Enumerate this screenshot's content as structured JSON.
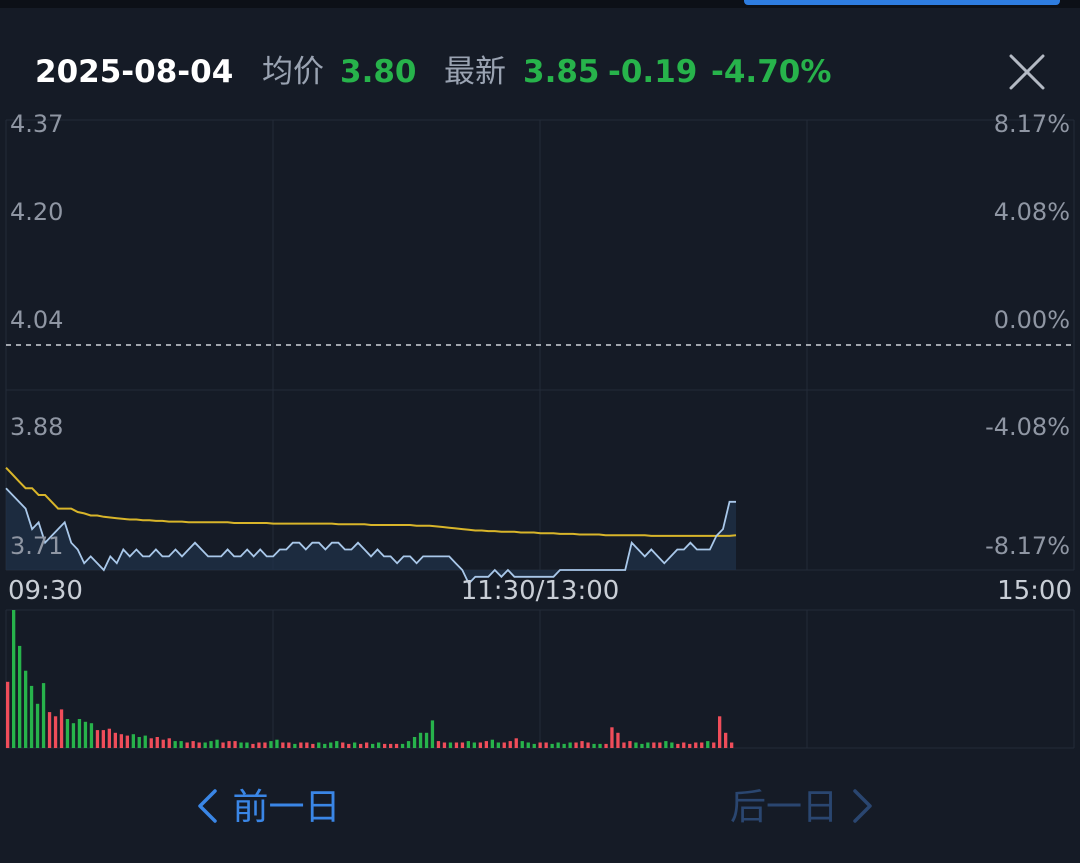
{
  "header": {
    "date": "2025-08-04",
    "avg_label": "均价",
    "avg_value": "3.80",
    "latest_label": "最新",
    "latest_value": "3.85",
    "change": "-0.19",
    "change_pct": "-4.70%"
  },
  "nav": {
    "prev_label": "前一日",
    "next_label": "后一日"
  },
  "colors": {
    "background": "#151b26",
    "price_line": "#a9c8ea",
    "avg_line": "#d8b52a",
    "up": "#ef4d5a",
    "down": "#27b34b",
    "prev_nav": "#3a86e6",
    "next_nav_disabled": "#2a4670"
  },
  "chart_data": {
    "type": "line",
    "ylim": [
      3.71,
      4.37
    ],
    "y_ticks_left": [
      "4.37",
      "4.20",
      "4.04",
      "3.88",
      "3.71"
    ],
    "y_ticks_right": [
      "8.17%",
      "4.08%",
      "0.00%",
      "-4.08%",
      "-8.17%"
    ],
    "x_ticks": [
      "09:30",
      "11:30/13:00",
      "15:00"
    ],
    "prev_close": 4.04,
    "series": [
      {
        "key": "price",
        "values": [
          3.83,
          3.82,
          3.81,
          3.8,
          3.77,
          3.78,
          3.75,
          3.76,
          3.77,
          3.78,
          3.75,
          3.74,
          3.72,
          3.73,
          3.72,
          3.71,
          3.73,
          3.72,
          3.74,
          3.73,
          3.74,
          3.73,
          3.73,
          3.74,
          3.73,
          3.73,
          3.74,
          3.73,
          3.74,
          3.75,
          3.74,
          3.73,
          3.73,
          3.73,
          3.74,
          3.73,
          3.73,
          3.74,
          3.73,
          3.74,
          3.73,
          3.73,
          3.74,
          3.74,
          3.75,
          3.75,
          3.74,
          3.75,
          3.75,
          3.74,
          3.75,
          3.75,
          3.74,
          3.74,
          3.75,
          3.74,
          3.73,
          3.74,
          3.73,
          3.73,
          3.72,
          3.73,
          3.73,
          3.72,
          3.73,
          3.73,
          3.73,
          3.73,
          3.73,
          3.72,
          3.71,
          3.69,
          3.7,
          3.7,
          3.7,
          3.71,
          3.7,
          3.71,
          3.7,
          3.7,
          3.7,
          3.7,
          3.7,
          3.7,
          3.7,
          3.71,
          3.71,
          3.71,
          3.71,
          3.71,
          3.71,
          3.71,
          3.71,
          3.71,
          3.71,
          3.71,
          3.75,
          3.74,
          3.73,
          3.74,
          3.73,
          3.72,
          3.73,
          3.74,
          3.74,
          3.75,
          3.74,
          3.74,
          3.74,
          3.76,
          3.77,
          3.81,
          3.81
        ]
      },
      {
        "key": "average",
        "values": [
          3.86,
          3.85,
          3.84,
          3.83,
          3.83,
          3.82,
          3.82,
          3.81,
          3.8,
          3.8,
          3.8,
          3.795,
          3.793,
          3.79,
          3.79,
          3.788,
          3.787,
          3.786,
          3.785,
          3.784,
          3.784,
          3.783,
          3.783,
          3.782,
          3.782,
          3.781,
          3.781,
          3.781,
          3.78,
          3.78,
          3.78,
          3.78,
          3.78,
          3.78,
          3.78,
          3.779,
          3.779,
          3.779,
          3.779,
          3.779,
          3.779,
          3.778,
          3.778,
          3.778,
          3.778,
          3.778,
          3.778,
          3.778,
          3.778,
          3.778,
          3.778,
          3.777,
          3.777,
          3.777,
          3.777,
          3.777,
          3.776,
          3.776,
          3.776,
          3.776,
          3.776,
          3.776,
          3.776,
          3.775,
          3.775,
          3.775,
          3.774,
          3.773,
          3.772,
          3.771,
          3.77,
          3.769,
          3.768,
          3.768,
          3.767,
          3.767,
          3.766,
          3.766,
          3.766,
          3.765,
          3.765,
          3.765,
          3.764,
          3.764,
          3.764,
          3.763,
          3.763,
          3.763,
          3.762,
          3.762,
          3.762,
          3.762,
          3.761,
          3.761,
          3.761,
          3.761,
          3.761,
          3.761,
          3.761,
          3.76,
          3.76,
          3.76,
          3.76,
          3.76,
          3.76,
          3.76,
          3.76,
          3.76,
          3.76,
          3.76,
          3.76,
          3.76,
          3.761
        ]
      }
    ],
    "volume": {
      "values": [
        48,
        100,
        74,
        56,
        45,
        32,
        47,
        26,
        23,
        28,
        21,
        18,
        21,
        19,
        18,
        13,
        13,
        14,
        11,
        10,
        9,
        10,
        8,
        9,
        7,
        8,
        6,
        7,
        5,
        5,
        4,
        5,
        4,
        4,
        5,
        6,
        4,
        5,
        5,
        4,
        4,
        3,
        4,
        4,
        5,
        6,
        4,
        4,
        3,
        4,
        4,
        3,
        4,
        3,
        4,
        5,
        4,
        3,
        4,
        3,
        4,
        3,
        4,
        3,
        3,
        3,
        3,
        5,
        8,
        11,
        11,
        20,
        5,
        4,
        4,
        4,
        4,
        5,
        4,
        4,
        5,
        6,
        4,
        4,
        5,
        7,
        5,
        4,
        3,
        4,
        4,
        3,
        4,
        3,
        4,
        4,
        5,
        4,
        3,
        3,
        3,
        15,
        11,
        4,
        5,
        4,
        3,
        4,
        4,
        4,
        5,
        4,
        3,
        4,
        3,
        4,
        4,
        5,
        4,
        23,
        11,
        4
      ],
      "colors": [
        "up",
        "down",
        "down",
        "down",
        "down",
        "down",
        "down",
        "up",
        "up",
        "up",
        "down",
        "down",
        "down",
        "down",
        "down",
        "up",
        "up",
        "up",
        "up",
        "up",
        "up",
        "down",
        "down",
        "down",
        "up",
        "up",
        "up",
        "up",
        "down",
        "down",
        "up",
        "up",
        "up",
        "down",
        "down",
        "down",
        "up",
        "up",
        "up",
        "down",
        "down",
        "up",
        "up",
        "up",
        "down",
        "down",
        "up",
        "up",
        "down",
        "up",
        "up",
        "up",
        "down",
        "down",
        "down",
        "down",
        "up",
        "up",
        "down",
        "up",
        "up",
        "down",
        "down",
        "up",
        "up",
        "up",
        "down",
        "down",
        "down",
        "down",
        "down",
        "down",
        "up",
        "up",
        "down",
        "up",
        "up",
        "down",
        "down",
        "up",
        "up",
        "down",
        "down",
        "up",
        "up",
        "up",
        "down",
        "down",
        "down",
        "up",
        "up",
        "down",
        "down",
        "down",
        "down",
        "up",
        "up",
        "up",
        "down",
        "down",
        "up",
        "up",
        "up",
        "up",
        "up",
        "down",
        "down",
        "down",
        "up",
        "up",
        "down",
        "down",
        "up",
        "up",
        "up",
        "up",
        "up",
        "down",
        "up",
        "up",
        "up",
        "up"
      ]
    }
  }
}
